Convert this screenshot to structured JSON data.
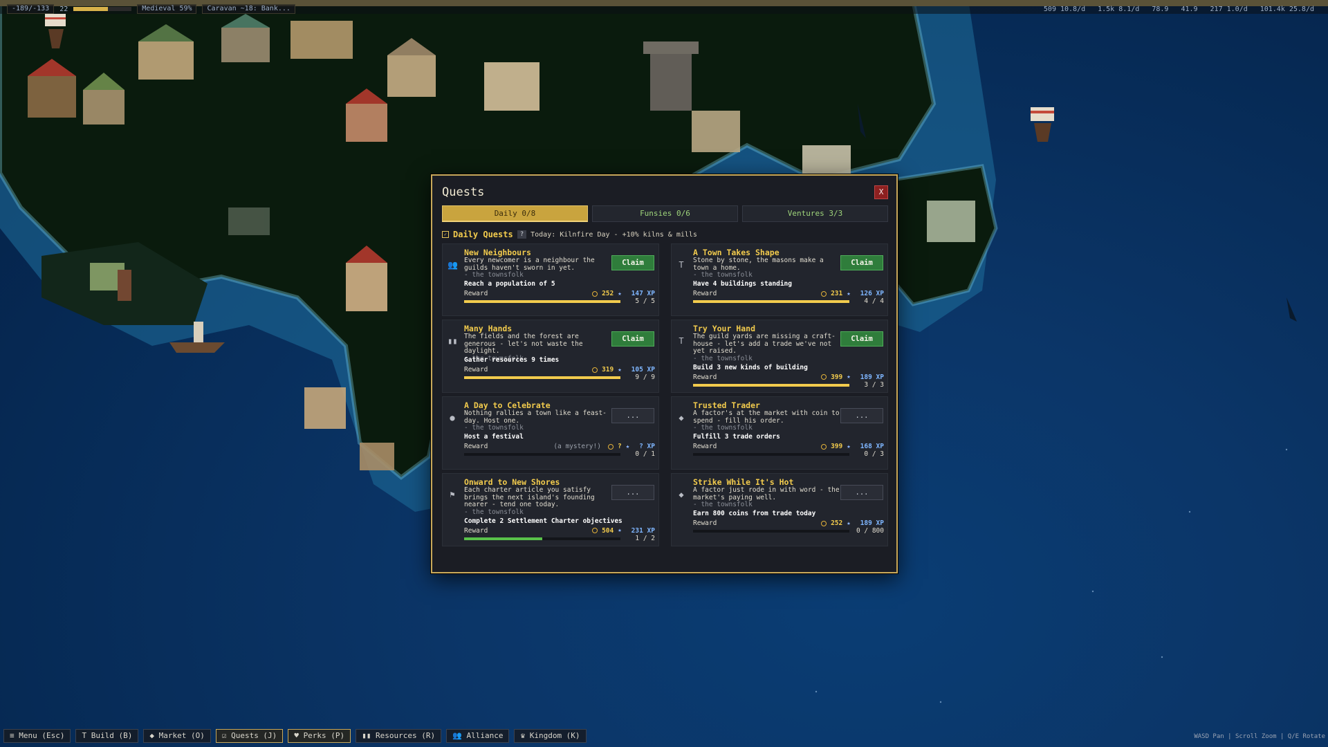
{
  "topbar": {
    "left": [
      "-189/-133",
      "22",
      "Medieval 59%",
      "Caravan ~18: Bank..."
    ],
    "medieval_progress": 0.59,
    "right": [
      "509 10.8/d",
      "1.5k 8.1/d",
      "78.9",
      "41.9",
      "217 1.0/d",
      "101.4k 25.8/d"
    ]
  },
  "dialog": {
    "title": "Quests",
    "close_label": "X",
    "tabs": [
      {
        "label": "Daily 0/8",
        "active": true
      },
      {
        "label": "Funsies 0/6",
        "active": false
      },
      {
        "label": "Ventures 3/3",
        "active": false
      }
    ],
    "section_title": "Daily Quests",
    "help_label": "?",
    "today_text": "Today: Kilnfire Day - +10% kilns & mills"
  },
  "quests": [
    {
      "title": "New Neighbours",
      "icon": "people-icon",
      "desc": "Every newcomer is a neighbour the guilds haven't sworn in yet.",
      "by": "- the townsfolk",
      "objective": "Reach a population of 5",
      "reward_label": "Reward",
      "coins": "252",
      "xp": "147 XP",
      "progress": 1.0,
      "progress_text": "5 / 5",
      "bar_color": "yellow",
      "button": "Claim",
      "claimable": true,
      "mystery": ""
    },
    {
      "title": "A Town Takes Shape",
      "icon": "hammer-icon",
      "desc": "Stone by stone, the masons make a town a home.",
      "by": "- the townsfolk",
      "objective": "Have 4 buildings standing",
      "reward_label": "Reward",
      "coins": "231",
      "xp": "126 XP",
      "progress": 1.0,
      "progress_text": "4 / 4",
      "bar_color": "yellow",
      "button": "Claim",
      "claimable": true,
      "mystery": ""
    },
    {
      "title": "Many Hands",
      "icon": "bar-chart-icon",
      "desc": "The fields and the forest are generous - let's not waste the daylight.",
      "by": "- the townsfolk",
      "objective": "Gather resources 9 times",
      "reward_label": "Reward",
      "coins": "319",
      "xp": "105 XP",
      "progress": 1.0,
      "progress_text": "9 / 9",
      "bar_color": "yellow",
      "button": "Claim",
      "claimable": true,
      "mystery": ""
    },
    {
      "title": "Try Your Hand",
      "icon": "hammer-icon",
      "desc": "The guild yards are missing a craft-house - let's add a trade we've not yet raised.",
      "by": "- the townsfolk",
      "objective": "Build 3 new kinds of building",
      "reward_label": "Reward",
      "coins": "399",
      "xp": "189 XP",
      "progress": 1.0,
      "progress_text": "3 / 3",
      "bar_color": "yellow",
      "button": "Claim",
      "claimable": true,
      "mystery": ""
    },
    {
      "title": "A Day to Celebrate",
      "icon": "balloon-icon",
      "desc": "Nothing rallies a town like a feast-day. Host one.",
      "by": "- the townsfolk",
      "objective": "Host a festival",
      "reward_label": "Reward",
      "coins": "?",
      "xp": "? XP",
      "progress": 0.0,
      "progress_text": "0 / 1",
      "bar_color": "yellow",
      "button": "...",
      "claimable": false,
      "mystery": "(a mystery!)"
    },
    {
      "title": "Trusted Trader",
      "icon": "tag-icon",
      "desc": "A factor's at the market with coin to spend - fill his order.",
      "by": "- the townsfolk",
      "objective": "Fulfill 3 trade orders",
      "reward_label": "Reward",
      "coins": "399",
      "xp": "168 XP",
      "progress": 0.0,
      "progress_text": "0 / 3",
      "bar_color": "yellow",
      "button": "...",
      "claimable": false,
      "mystery": ""
    },
    {
      "title": "Onward to New Shores",
      "icon": "flag-icon",
      "desc": "Each charter article you satisfy brings the next island's founding nearer - tend one today.",
      "by": "- the townsfolk",
      "objective": "Complete 2 Settlement Charter objectives",
      "reward_label": "Reward",
      "coins": "504",
      "xp": "231 XP",
      "progress": 0.5,
      "progress_text": "1 / 2",
      "bar_color": "green",
      "button": "...",
      "claimable": false,
      "mystery": ""
    },
    {
      "title": "Strike While It's Hot",
      "icon": "tag-icon",
      "desc": "A factor just rode in with word - the market's paying well.",
      "by": "- the townsfolk",
      "objective": "Earn 800 coins from trade today",
      "reward_label": "Reward",
      "coins": "252",
      "xp": "189 XP",
      "progress": 0.0,
      "progress_text": "0 / 800",
      "bar_color": "yellow",
      "button": "...",
      "claimable": false,
      "mystery": ""
    }
  ],
  "bottom_nav": [
    {
      "label": "Menu (Esc)",
      "icon": "menu-icon",
      "active": false
    },
    {
      "label": "Build (B)",
      "icon": "hammer-icon",
      "active": false
    },
    {
      "label": "Market (O)",
      "icon": "tag-icon",
      "active": false
    },
    {
      "label": "Quests (J)",
      "icon": "checkbox-icon",
      "active": true
    },
    {
      "label": "Perks (P)",
      "icon": "heart-icon",
      "active": true
    },
    {
      "label": "Resources (R)",
      "icon": "bar-chart-icon",
      "active": false
    },
    {
      "label": "Alliance",
      "icon": "people-icon",
      "active": false
    },
    {
      "label": "Kingdom (K)",
      "icon": "crown-icon",
      "active": false
    }
  ],
  "controls_hint": "WASD Pan | Scroll Zoom | Q/E Rotate"
}
